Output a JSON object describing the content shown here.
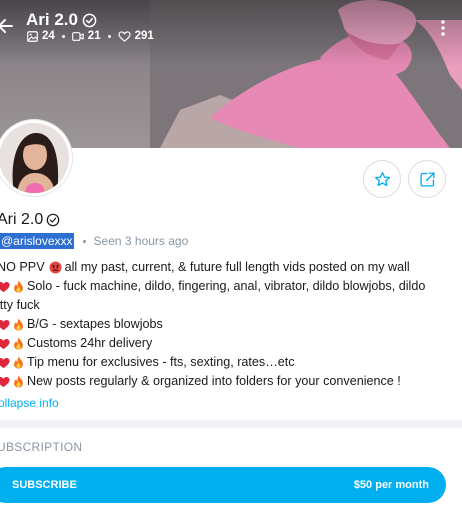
{
  "header": {
    "title": "Ari 2.0",
    "stats": {
      "photos": "24",
      "videos": "21",
      "likes": "291"
    }
  },
  "profile": {
    "name": "Ari 2.0",
    "handle": "@arislovexxx",
    "seen": "Seen  3 hours ago"
  },
  "bio": {
    "lines": [
      {
        "emoji": [
          "angry-face"
        ],
        "text": "NO PPV",
        "after": " all my past, current, & future full length vids posted on my wall"
      },
      {
        "emoji": [
          "heart",
          "fire"
        ],
        "text": "Solo - fuck machine, dildo, fingering, anal, vibrator, dildo blowjobs, dildo"
      },
      {
        "emoji": [],
        "text": "itty fuck"
      },
      {
        "emoji": [
          "heart",
          "fire"
        ],
        "text": "B/G - sextapes blowjobs"
      },
      {
        "emoji": [
          "heart",
          "fire"
        ],
        "text": " Customs 24hr delivery"
      },
      {
        "emoji": [
          "heart",
          "fire"
        ],
        "text": " Tip menu for exclusives - fts, sexting, rates…etc"
      },
      {
        "emoji": [
          "heart",
          "fire"
        ],
        "text": " New posts regularly & organized into folders for your convenience !"
      }
    ],
    "collapse_label": "ollapse info"
  },
  "subscription": {
    "section_title": "UBSCRIPTION",
    "button_label": "SUBSCRIBE",
    "price": "$50 per month"
  },
  "icons": {
    "back": "arrow-left-icon",
    "verified": "verified-badge-icon",
    "photos": "image-icon",
    "videos": "video-icon",
    "likes": "heart-outline-icon",
    "more": "more-vertical-icon",
    "favorite": "star-icon",
    "share": "share-icon"
  },
  "colors": {
    "accent": "#00aff0",
    "handle_highlight": "#2c6fd1",
    "muted": "#8a96a3"
  }
}
